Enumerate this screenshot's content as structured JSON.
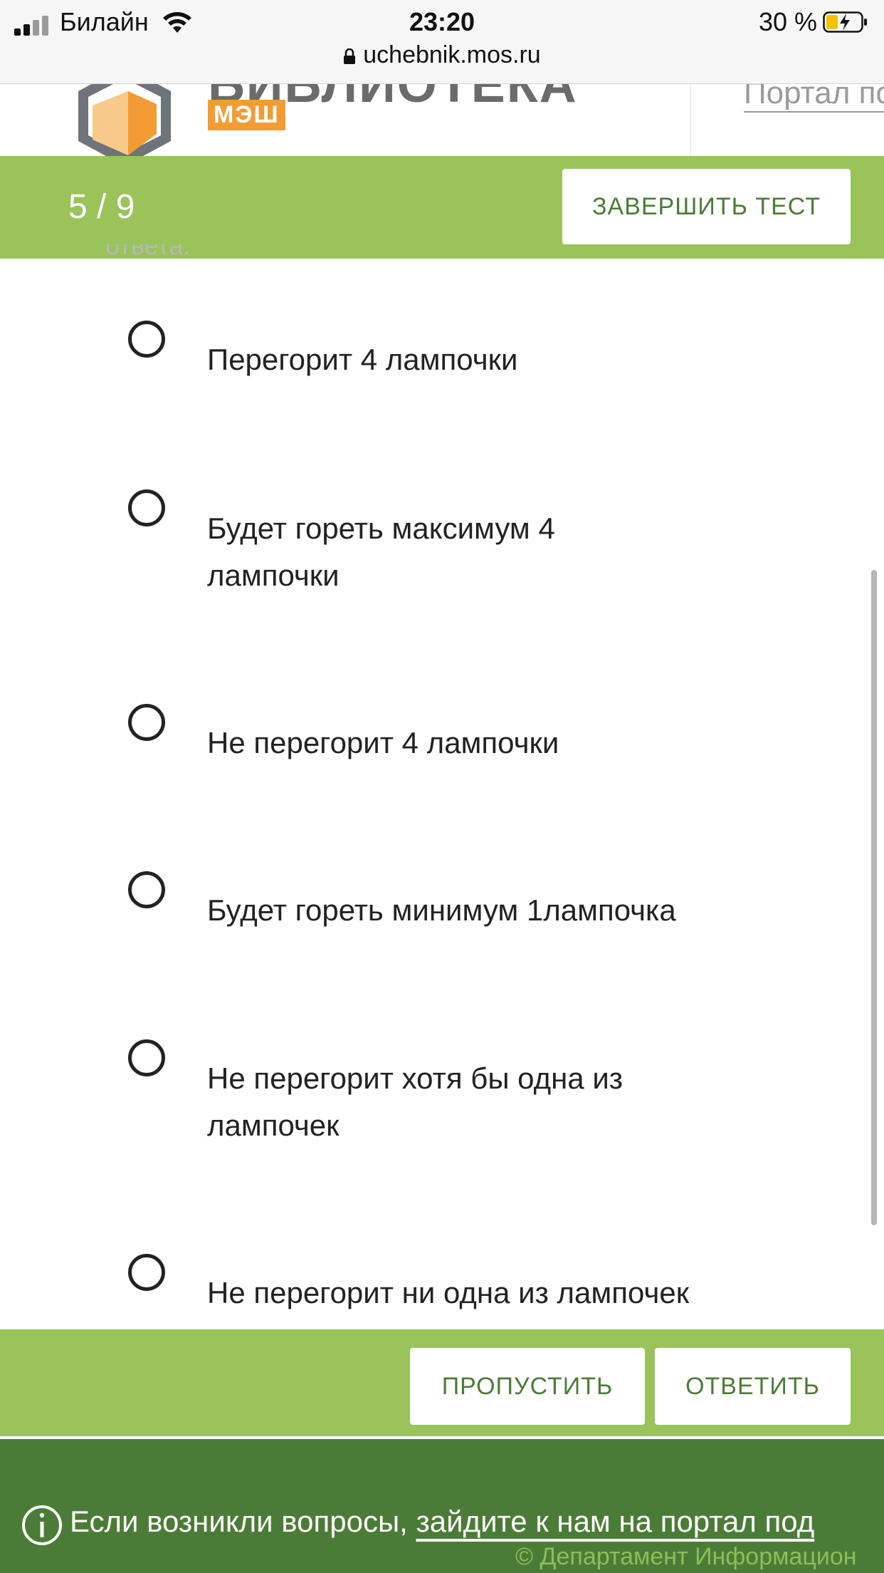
{
  "status_bar": {
    "carrier": "Билайн",
    "time": "23:20",
    "battery": "30 %",
    "url": "uchebnik.mos.ru"
  },
  "header": {
    "logo_text": "БИБЛИОТЕКА",
    "logo_badge": "МЭШ",
    "portal_link": "Портал по"
  },
  "test": {
    "progress": "5 / 9",
    "finish_label": "ЗАВЕРШИТЬ ТЕСТ",
    "instruction_cutoff": "ответа."
  },
  "options": [
    {
      "label": "Перегорит 4 лампочки",
      "selected": false
    },
    {
      "label": "Будет гореть максимум 4 лампочки",
      "selected": false
    },
    {
      "label": "Не перегорит 4 лампочки",
      "selected": false
    },
    {
      "label": "Будет гореть минимум 1лампочка",
      "selected": false
    },
    {
      "label": "Не перегорит хотя бы одна из лампочек",
      "selected": false
    },
    {
      "label": "Не перегорит ни одна из лампочек",
      "selected": false
    }
  ],
  "actions": {
    "skip_label": "ПРОПУСТИТЬ",
    "answer_label": "ОТВЕТИТЬ"
  },
  "footer": {
    "text": "Если возникли вопросы, ",
    "link": "зайдите к нам на портал под",
    "copyright": "© Департамент Информацион"
  },
  "colors": {
    "accent_green": "#9ac35a",
    "dark_green": "#4b7c37",
    "logo_orange": "#f39c33"
  }
}
